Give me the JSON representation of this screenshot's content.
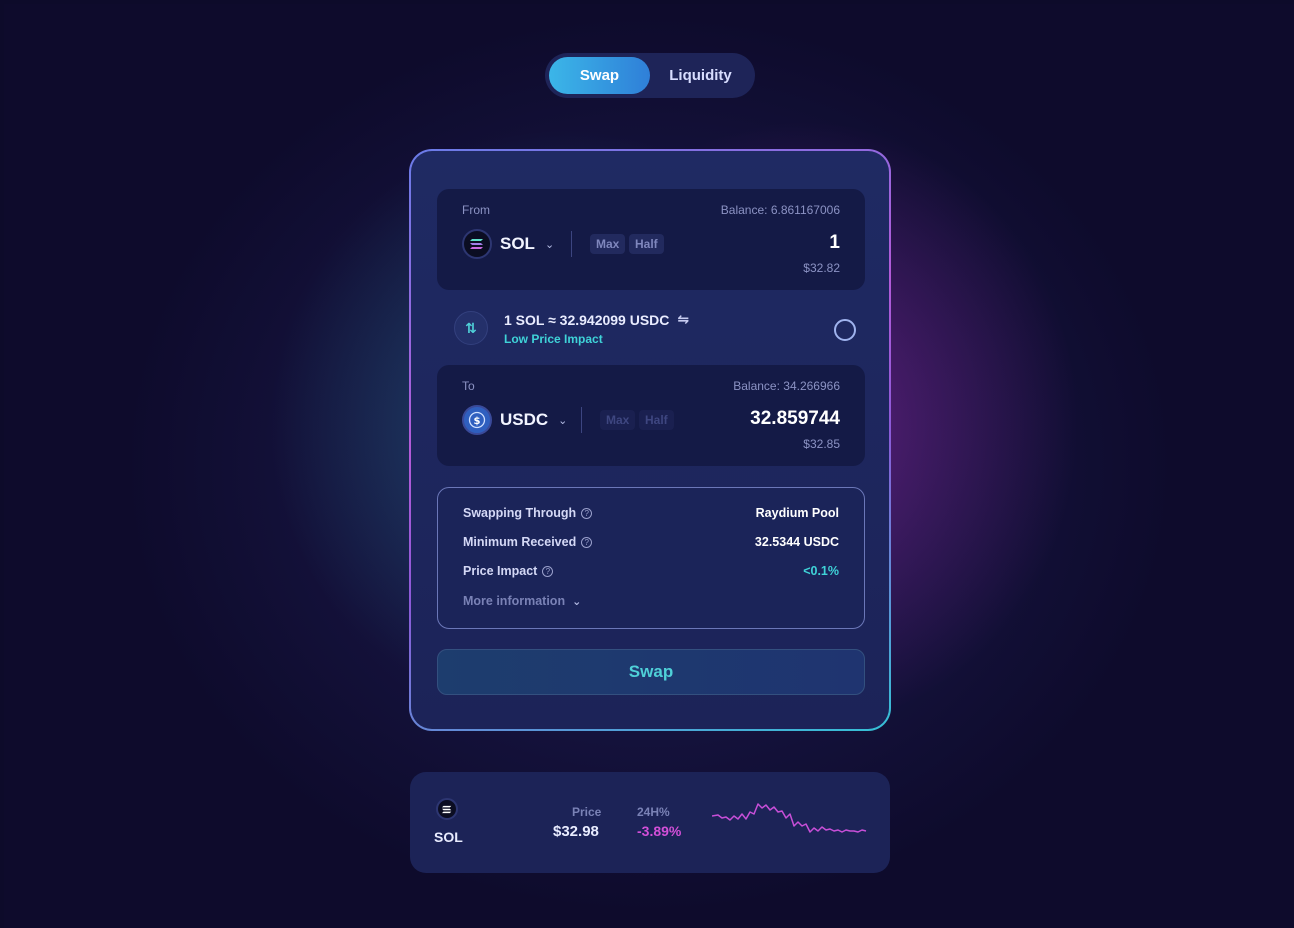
{
  "tabs": [
    {
      "label": "Swap",
      "active": true
    },
    {
      "label": "Liquidity",
      "active": false
    }
  ],
  "from": {
    "label": "From",
    "balance": "Balance: 6.861167006",
    "token": "SOL",
    "max_label": "Max",
    "half_label": "Half",
    "amount": "1",
    "usd_value": "$32.82"
  },
  "rate": {
    "text": "1 SOL ≈ 32.942099 USDC",
    "swap_glyph": "⇋",
    "impact_label": "Low Price Impact",
    "direction_glyph": "⇅"
  },
  "to": {
    "label": "To",
    "balance": "Balance: 34.266966",
    "token": "USDC",
    "max_label": "Max",
    "half_label": "Half",
    "amount": "32.859744",
    "usd_value": "$32.85"
  },
  "info": {
    "rows": [
      {
        "key": "Swapping Through",
        "value": "Raydium Pool"
      },
      {
        "key": "Minimum Received",
        "value": "32.5344 USDC"
      },
      {
        "key": "Price Impact",
        "value": "<0.1%"
      }
    ],
    "more_label": "More information"
  },
  "swap_button": "Swap",
  "price_card": {
    "symbol": "SOL",
    "price_label": "Price",
    "price": "$32.98",
    "change_label": "24H%",
    "change": "-3.89%"
  },
  "colors": {
    "accent_cyan": "#3fd3d8",
    "accent_magenta": "#d24fd8",
    "tab_active": "#3bb6e8"
  },
  "icons": {
    "sol": "solana-icon",
    "usdc": "usdc-icon",
    "help": "question-circle-icon",
    "refresh": "refresh-ring-icon"
  }
}
